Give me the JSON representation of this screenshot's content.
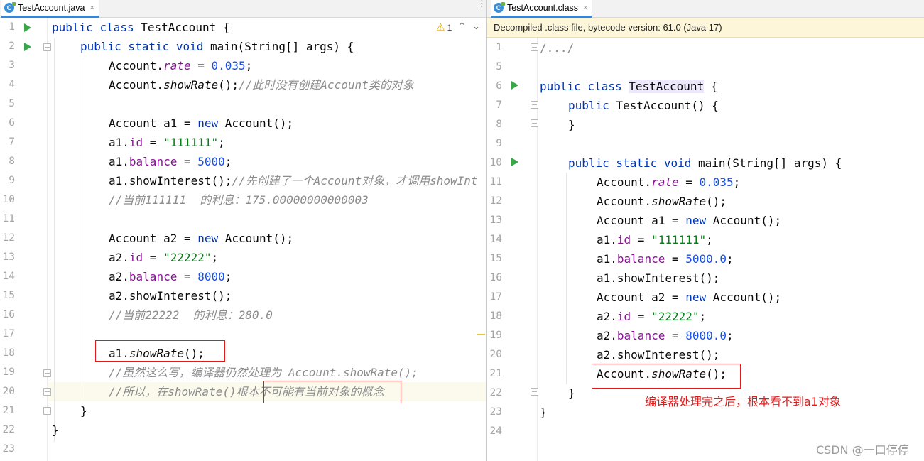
{
  "left_tab": {
    "label": "TestAccount.java",
    "close": "×"
  },
  "right_tab": {
    "label": "TestAccount.class",
    "close": "×"
  },
  "menu_dots": "⋮",
  "inspection": {
    "warning_icon": "⚠",
    "count": "1"
  },
  "nav": {
    "up": "⌃",
    "down": "⌄"
  },
  "decompiled_banner": "Decompiled .class file, bytecode version: 61.0 (Java 17)",
  "left_line_numbers": [
    "1",
    "2",
    "3",
    "4",
    "5",
    "6",
    "7",
    "8",
    "9",
    "10",
    "11",
    "12",
    "13",
    "14",
    "15",
    "16",
    "17",
    "18",
    "19",
    "20",
    "21",
    "22",
    "23"
  ],
  "right_line_numbers": [
    "1",
    "5",
    "6",
    "7",
    "8",
    "9",
    "10",
    "11",
    "12",
    "13",
    "14",
    "15",
    "16",
    "17",
    "18",
    "19",
    "20",
    "21",
    "22",
    "23",
    "24"
  ],
  "left_code": {
    "l1": {
      "kw1": "public",
      "kw2": "class",
      "name": "TestAccount {"
    },
    "l2": {
      "kw": "public static void",
      "rest": " main(String[] args) {"
    },
    "l3": {
      "a": "Account.",
      "field": "rate",
      "b": " = ",
      "num": "0.035",
      "c": ";"
    },
    "l4": {
      "a": "Account.",
      "method": "showRate",
      "b": "();",
      "cmt": "//此时没有创建Account类的对象"
    },
    "l6": {
      "a": "Account a1 = ",
      "kw": "new",
      "b": " Account();"
    },
    "l7": {
      "a": "a1.",
      "field": "id",
      "b": " = ",
      "str": "\"111111\"",
      "c": ";"
    },
    "l8": {
      "a": "a1.",
      "field": "balance",
      "b": " = ",
      "num": "5000",
      "c": ";"
    },
    "l9": {
      "a": "a1.showInterest();",
      "cmt": "//先创建了一个Account对象，才调用showInt"
    },
    "l10": {
      "cmt": "//当前111111  的利息：175.00000000000003"
    },
    "l12": {
      "a": "Account a2 = ",
      "kw": "new",
      "b": " Account();"
    },
    "l13": {
      "a": "a2.",
      "field": "id",
      "b": " = ",
      "str": "\"22222\"",
      "c": ";"
    },
    "l14": {
      "a": "a2.",
      "field": "balance",
      "b": " = ",
      "num": "8000",
      "c": ";"
    },
    "l15": {
      "a": "a2.showInterest();"
    },
    "l16": {
      "cmt": "//当前22222  的利息：280.0"
    },
    "l18": {
      "a": "a1.",
      "method": "showRate",
      "b": "();"
    },
    "l19": {
      "cmt": "//虽然这么写，编译器仍然处理为 Account.showRate();"
    },
    "l20": {
      "cmt": "//所以，在showRate()根本不可能有当前对象的概念"
    },
    "l21": {
      "a": "}"
    },
    "l22": {
      "a": "}"
    }
  },
  "right_code": {
    "l1": {
      "a": "/.../"
    },
    "l6": {
      "kw": "public class",
      "sp": " ",
      "name": "TestAccount",
      "b": " {"
    },
    "l7": {
      "kw": "public",
      "b": " TestAccount() {"
    },
    "l8": {
      "a": "}"
    },
    "l10": {
      "kw": "public static void",
      "rest": " main(String[] args) {"
    },
    "l11": {
      "a": "Account.",
      "field": "rate",
      "b": " = ",
      "num": "0.035",
      "c": ";"
    },
    "l12": {
      "a": "Account.",
      "method": "showRate",
      "b": "();"
    },
    "l13": {
      "a": "Account a1 = ",
      "kw": "new",
      "b": " Account();"
    },
    "l14": {
      "a": "a1.",
      "field": "id",
      "b": " = ",
      "str": "\"111111\"",
      "c": ";"
    },
    "l15": {
      "a": "a1.",
      "field": "balance",
      "b": " = ",
      "num": "5000.0",
      "c": ";"
    },
    "l16": {
      "a": "a1.showInterest();"
    },
    "l17": {
      "a": "Account a2 = ",
      "kw": "new",
      "b": " Account();"
    },
    "l18": {
      "a": "a2.",
      "field": "id",
      "b": " = ",
      "str": "\"22222\"",
      "c": ";"
    },
    "l19": {
      "a": "a2.",
      "field": "balance",
      "b": " = ",
      "num": "8000.0",
      "c": ";"
    },
    "l20": {
      "a": "a2.showInterest();"
    },
    "l21": {
      "a": "Account.",
      "method": "showRate",
      "b": "();"
    },
    "l22": {
      "a": "}"
    },
    "l23": {
      "a": "}"
    }
  },
  "annotation": "编译器处理完之后，根本看不到a1对象",
  "watermark": "CSDN @一口停停",
  "colors": {
    "keyword": "#0033b3",
    "field": "#871094",
    "string": "#067d17",
    "number": "#1750eb",
    "comment": "#8c8c8c",
    "annotation": "#e01b1b",
    "run_icon": "#3aa64a"
  }
}
